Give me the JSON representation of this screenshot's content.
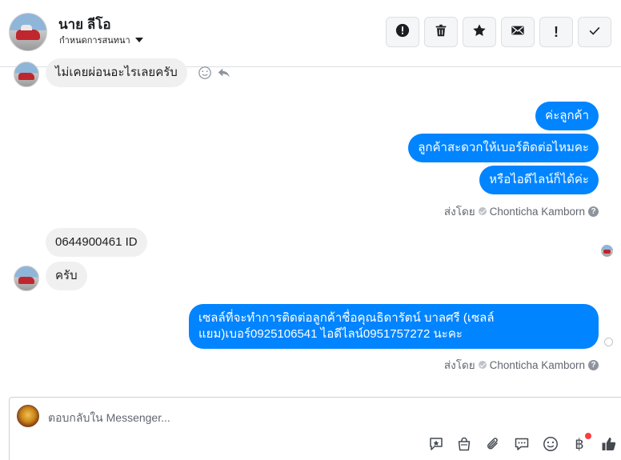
{
  "header": {
    "contact_name": "นาย ลีโอ",
    "conversation_label": "กำหนดการสนทนา",
    "toolbar": [
      {
        "icon": "alert-circle-icon"
      },
      {
        "icon": "trash-icon"
      },
      {
        "icon": "star-icon"
      },
      {
        "icon": "envelope-icon"
      },
      {
        "icon": "exclamation-icon",
        "glyph": "!"
      },
      {
        "icon": "check-icon"
      }
    ]
  },
  "messages": {
    "m1": "ไม่เคยผ่อนอะไรเลยครับ",
    "m2": "ค่ะลูกค้า",
    "m3": "ลูกค้าสะดวกให้เบอร์ติดต่อไหมคะ",
    "m4": "หรือไอดีไลน์ก็ได้ค่ะ",
    "m5": "0644900461 ID",
    "m6": "ครับ",
    "m7": "เซลล์ที่จะทำการติดต่อลูกค้าชื่อคุณธิดารัตน์ บาลศรี (เซลล์แยม)เบอร์0925106541 ไอดีไลน์0951757272 นะคะ"
  },
  "sent_by": {
    "prefix": "ส่งโดย",
    "agent": "Chonticha Kamborn"
  },
  "composer": {
    "placeholder": "ตอบกลับใน Messenger...",
    "tools": [
      "saved-reply-icon",
      "shop-bag-icon",
      "attachment-icon",
      "chat-bubbles-icon",
      "emoji-icon",
      "baht-payment-icon",
      "like-icon"
    ],
    "payment_glyph": "฿",
    "notification_color": "#fa3e3e"
  },
  "colors": {
    "outgoing_bubble": "#0084ff",
    "incoming_bubble": "#f1f0f0"
  }
}
